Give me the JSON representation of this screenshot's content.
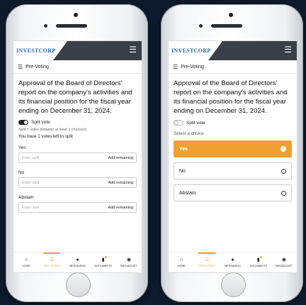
{
  "app": {
    "logo": "INVESTCORP",
    "menu_icon": "hamburger-icon",
    "section": "Pre-Voting",
    "title": "Approval of the Board of Directors' report on the company's activities and its financial position for the fiscal year ending on December 31, 2024."
  },
  "left": {
    "split_label": "Split vote",
    "split_on": true,
    "note": "Split 1 votes between at least 1 choice(s)",
    "remaining": "You have 1 votes left to split",
    "fields": [
      {
        "label": "Yes",
        "placeholder": "Enter split",
        "action": "Add remaining"
      },
      {
        "label": "No",
        "placeholder": "Enter split",
        "action": "Add remaining"
      },
      {
        "label": "Abstain",
        "placeholder": "Enter split",
        "action": "Add remaining"
      }
    ]
  },
  "right": {
    "split_label": "Split vote",
    "split_on": false,
    "select_label": "Select a choice",
    "choices": [
      {
        "label": "Yes",
        "selected": true
      },
      {
        "label": "No",
        "selected": false
      },
      {
        "label": "Abstain",
        "selected": false
      }
    ]
  },
  "nav": [
    {
      "label": "HOME",
      "icon": "home-icon",
      "glyph": "⌂"
    },
    {
      "label": "PRE-VOTING",
      "icon": "ballot-icon",
      "glyph": "☰",
      "active": true
    },
    {
      "label": "MESSAGING",
      "icon": "chat-icon",
      "glyph": "●"
    },
    {
      "label": "DOCUMENTS",
      "icon": "document-icon",
      "glyph": "▮"
    },
    {
      "label": "BROADCAST",
      "icon": "broadcast-icon",
      "glyph": "◉"
    }
  ],
  "colors": {
    "accent": "#f0a030",
    "header_dark": "#3a4048",
    "logo": "#1f6aa8",
    "background": "#0c1a2b"
  }
}
